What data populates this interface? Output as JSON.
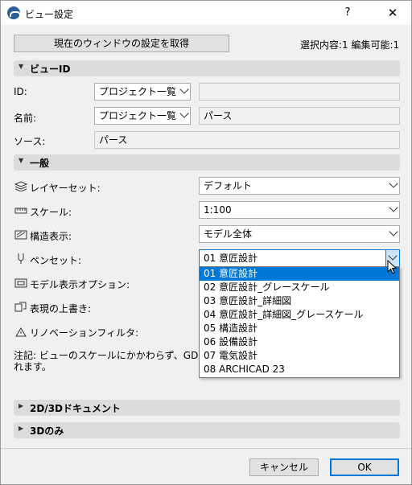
{
  "window": {
    "title": "ビュー設定",
    "help": "?",
    "close": "✕"
  },
  "toolbar": {
    "get_settings_label": "現在のウィンドウの設定を取得",
    "selection_info": "選択内容:1 編集可能:1"
  },
  "view_id": {
    "header": "ビューID",
    "id_label": "ID:",
    "id_select": "プロジェクト一覧",
    "id_value": "",
    "name_label": "名前:",
    "name_select": "プロジェクト一覧",
    "name_value": "パース",
    "source_label": "ソース:",
    "source_value": "パース"
  },
  "general": {
    "header": "一般",
    "layer_set_label": "レイヤーセット:",
    "layer_set_value": "デフォルト",
    "scale_label": "スケール:",
    "scale_value": "1:100",
    "structure_label": "構造表示:",
    "structure_value": "モデル全体",
    "pen_set_label": "ペンセット:",
    "pen_set_value": "01 意匠設計",
    "model_view_label": "モデル表示オプション:",
    "override_label": "表現の上書き:",
    "renovation_label": "リノベーションフィルタ:",
    "note_line1": "注記: ビューのスケールにかかわらず、GDLオブジェ",
    "note_line2": "れます。"
  },
  "pen_set_options": [
    "01 意匠設計",
    "02 意匠設計_グレースケール",
    "03 意匠設計_詳細図",
    "04 意匠設計_詳細図_グレースケール",
    "05 構造設計",
    "06 設備設計",
    "07 電気設計",
    "08 ARCHICAD 23"
  ],
  "collapsed_sections": {
    "doc": "2D/3Dドキュメント",
    "only3d": "3Dのみ"
  },
  "footer": {
    "cancel": "キャンセル",
    "ok": "OK"
  },
  "colors": {
    "selection": "#0078d7",
    "section_bg": "#dcdcdc"
  }
}
